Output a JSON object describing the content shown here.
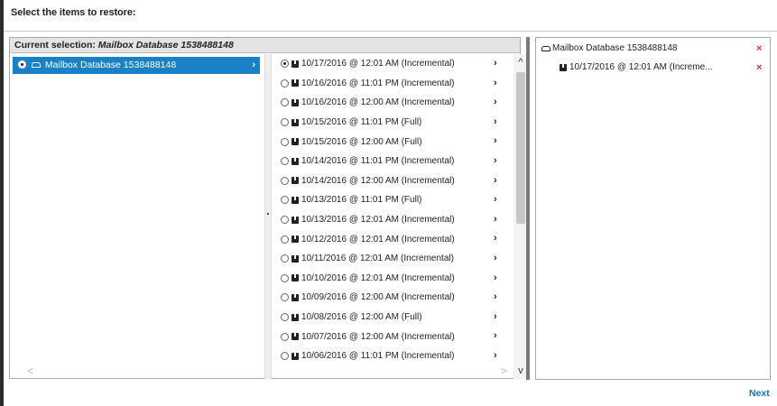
{
  "heading": "Select the items to restore:",
  "current_selection": {
    "label": "Current selection:",
    "value": "Mailbox Database 1538488148"
  },
  "database": {
    "name": "Mailbox Database 1538488148",
    "selected": true
  },
  "recovery_points": [
    {
      "label": "10/17/2016 @ 12:01 AM (Incremental)",
      "selected": true
    },
    {
      "label": "10/16/2016 @ 11:01 PM (Incremental)",
      "selected": false
    },
    {
      "label": "10/16/2016 @ 12:00 AM (Incremental)",
      "selected": false
    },
    {
      "label": "10/15/2016 @ 11:01 PM (Full)",
      "selected": false
    },
    {
      "label": "10/15/2016 @ 12:00 AM (Full)",
      "selected": false
    },
    {
      "label": "10/14/2016 @ 11:01 PM (Incremental)",
      "selected": false
    },
    {
      "label": "10/14/2016 @ 12:00 AM (Incremental)",
      "selected": false
    },
    {
      "label": "10/13/2016 @ 11:01 PM (Full)",
      "selected": false
    },
    {
      "label": "10/13/2016 @ 12:01 AM (Incremental)",
      "selected": false
    },
    {
      "label": "10/12/2016 @ 12:01 AM (Incremental)",
      "selected": false
    },
    {
      "label": "10/11/2016 @ 12:01 AM (Incremental)",
      "selected": false
    },
    {
      "label": "10/10/2016 @ 12:01 AM (Incremental)",
      "selected": false
    },
    {
      "label": "10/09/2016 @ 12:00 AM (Incremental)",
      "selected": false
    },
    {
      "label": "10/08/2016 @ 12:00 AM (Full)",
      "selected": false
    },
    {
      "label": "10/07/2016 @ 12:00 AM (Incremental)",
      "selected": false
    },
    {
      "label": "10/06/2016 @ 11:01 PM (Incremental)",
      "selected": false
    }
  ],
  "restore_list": {
    "database": "Mailbox Database 1538488148",
    "point": "10/17/2016 @ 12:01 AM (Increme...",
    "remove_glyph": "×"
  },
  "next_label": "Next",
  "colors": {
    "selected_row": "#1a81c7",
    "remove": "#e03030",
    "link": "#1a6fb3"
  }
}
